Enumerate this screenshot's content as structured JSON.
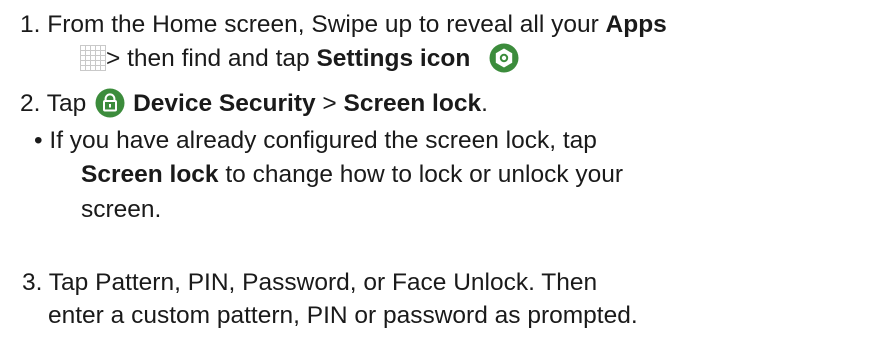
{
  "steps": {
    "s1_line1_pre": "1. From the Home screen, Swipe up to reveal all your ",
    "s1_line1_bold": "Apps",
    "s1_line2_a": "> then find and tap ",
    "s1_line2_bold": "Settings icon",
    "s2_pre": "2. Tap ",
    "s2_bold1": "Device Security",
    "s2_sep": " > ",
    "s2_bold2": "Screen lock",
    "s2_end": ".",
    "s2_bullet_line1": "• If you have already configured the screen lock, tap",
    "s2_bullet_line2_bold": "Screen lock",
    "s2_bullet_line2_rest": " to change how to lock or unlock your",
    "s2_bullet_line3": "screen.",
    "s3_line1": "3. Tap Pattern, PIN, Password, or Face Unlock. Then",
    "s3_line2": "enter a custom pattern, PIN or password as prompted."
  },
  "icons": {
    "apps": "apps-grid-icon",
    "settings": "settings-gear-icon",
    "security": "security-lock-icon",
    "accent": "#3c8c3c"
  }
}
